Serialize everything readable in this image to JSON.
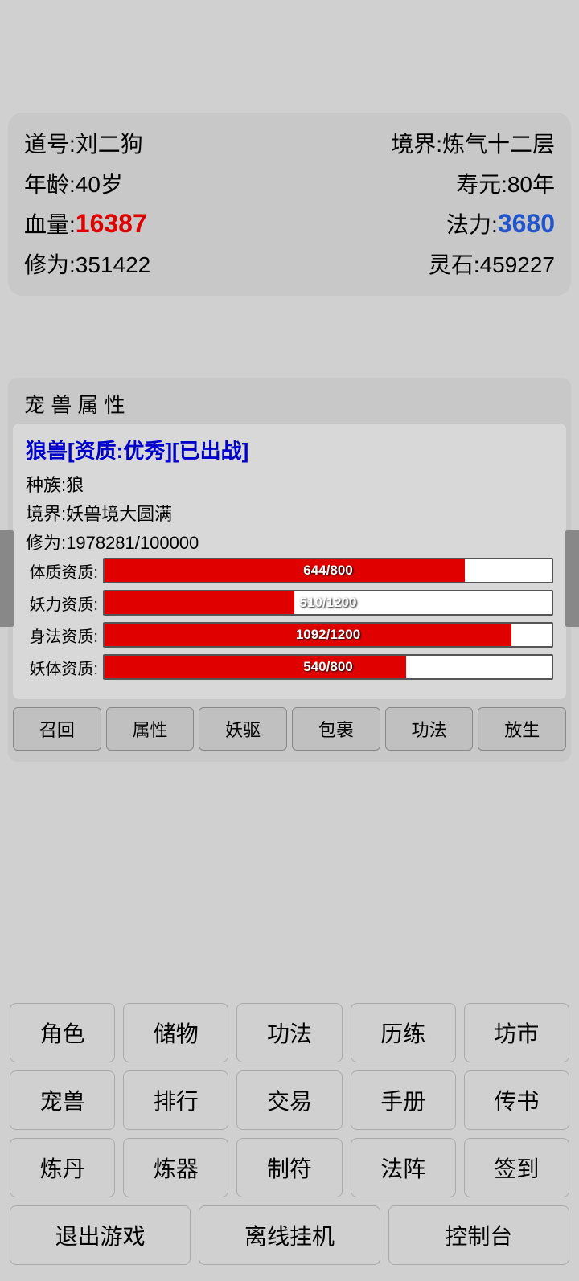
{
  "status": {
    "dao_hao_label": "道号:",
    "dao_hao_value": "刘二狗",
    "jing_jie_label": "境界:",
    "jing_jie_value": "炼气十二层",
    "nian_ling_label": "年龄:",
    "nian_ling_value": "40岁",
    "shou_yuan_label": "寿元:",
    "shou_yuan_value": "80年",
    "xue_liang_label": "血量:",
    "xue_liang_value": "16387",
    "fa_li_label": "法力:",
    "fa_li_value": "3680",
    "xiu_wei_label": "修为:",
    "xiu_wei_value": "351422",
    "ling_shi_label": "灵石:",
    "ling_shi_value": "459227"
  },
  "pet_panel": {
    "header": "宠 兽 属 性",
    "title": "狼兽[资质:优秀][已出战]",
    "species_label": "种族:",
    "species_value": "狼",
    "realm_label": "境界:",
    "realm_value": "妖兽境大圆满",
    "cultivation_label": "修为:",
    "cultivation_value": "1978281/100000",
    "bars": [
      {
        "label": "体质资质:",
        "current": 644,
        "max": 800,
        "text": "644/800",
        "pct": 80.5
      },
      {
        "label": "妖力资质:",
        "current": 510,
        "max": 1200,
        "text": "510/1200",
        "pct": 42.5
      },
      {
        "label": "身法资质:",
        "current": 1092,
        "max": 1200,
        "text": "1092/1200",
        "pct": 91.0
      },
      {
        "label": "妖体资质:",
        "current": 540,
        "max": 800,
        "text": "540/800",
        "pct": 67.5
      }
    ],
    "actions": [
      "召回",
      "属性",
      "妖驱",
      "包裹",
      "功法",
      "放生"
    ]
  },
  "grid": {
    "rows": [
      [
        "角色",
        "储物",
        "功法",
        "历练",
        "坊市"
      ],
      [
        "宠兽",
        "排行",
        "交易",
        "手册",
        "传书"
      ],
      [
        "炼丹",
        "炼器",
        "制符",
        "法阵",
        "签到"
      ],
      [
        "退出游戏",
        "离线挂机",
        "控制台"
      ]
    ]
  }
}
